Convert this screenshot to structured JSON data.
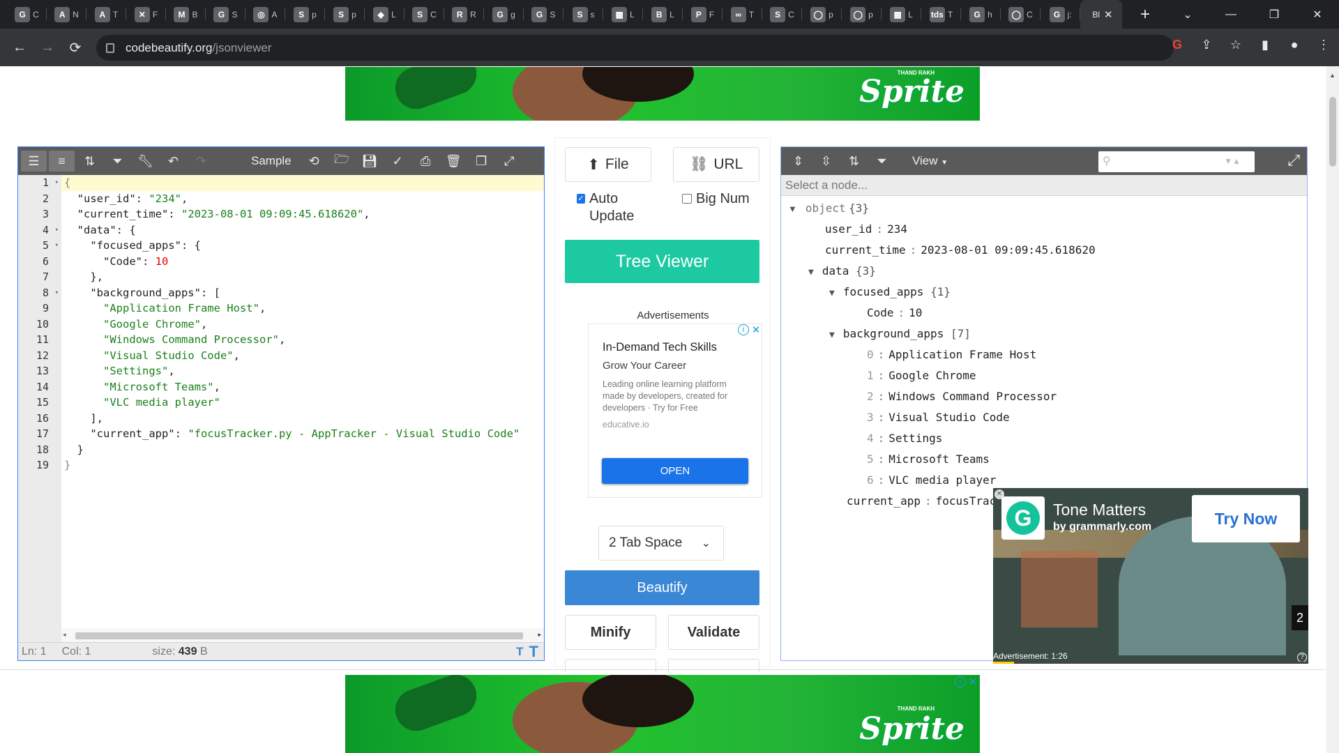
{
  "browser": {
    "tabs": [
      {
        "icon": "G",
        "title": "C"
      },
      {
        "icon": "A",
        "title": "N"
      },
      {
        "icon": "A",
        "title": "T"
      },
      {
        "icon": "✕",
        "title": "F"
      },
      {
        "icon": "M",
        "title": "B"
      },
      {
        "icon": "G",
        "title": "S"
      },
      {
        "icon": "◎",
        "title": "A"
      },
      {
        "icon": "S",
        "title": "p"
      },
      {
        "icon": "S",
        "title": "p"
      },
      {
        "icon": "◆",
        "title": "L"
      },
      {
        "icon": "S",
        "title": "C"
      },
      {
        "icon": "R",
        "title": "R"
      },
      {
        "icon": "G",
        "title": "g"
      },
      {
        "icon": "G",
        "title": "S"
      },
      {
        "icon": "S",
        "title": "s"
      },
      {
        "icon": "▦",
        "title": "L"
      },
      {
        "icon": "B",
        "title": "L"
      },
      {
        "icon": "P",
        "title": "F"
      },
      {
        "icon": "∞",
        "title": "T"
      },
      {
        "icon": "S",
        "title": "C"
      },
      {
        "icon": "◯",
        "title": "p"
      },
      {
        "icon": "◯",
        "title": "p"
      },
      {
        "icon": "▦",
        "title": "L"
      },
      {
        "icon": "tds",
        "title": "T"
      },
      {
        "icon": "G",
        "title": "h"
      },
      {
        "icon": "◯",
        "title": "C"
      },
      {
        "icon": "G",
        "title": "j:"
      }
    ],
    "active_tab": {
      "title": "Bl"
    },
    "new_tab": "+",
    "window_controls": {
      "dropdown": "⌄",
      "minimize": "—",
      "restore": "❐",
      "close": "✕"
    },
    "nav": {
      "back": "←",
      "forward": "→",
      "reload": "⟳"
    },
    "url_domain": "codebeautify.org",
    "url_path": "/jsonviewer"
  },
  "ads": {
    "banner_brand": "Sprite",
    "banner_tagline": "THAND RAKH",
    "middle_label": "Advertisements",
    "card": {
      "title": "In-Demand Tech Skills",
      "subtitle": "Grow Your Career",
      "description": "Leading online learning platform made by developers, created for developers · Try for Free",
      "domain": "educative.io",
      "cta": "OPEN"
    },
    "grammarly": {
      "title": "Tone Matters",
      "by": "by grammarly.com",
      "cta": "Try Now",
      "count": "2",
      "footer": "Advertisement: 1:26"
    }
  },
  "editor": {
    "sample_label": "Sample",
    "line_numbers": [
      "1",
      "2",
      "3",
      "4",
      "5",
      "6",
      "7",
      "8",
      "9",
      "10",
      "11",
      "12",
      "13",
      "14",
      "15",
      "16",
      "17",
      "18",
      "19"
    ],
    "status": {
      "ln_label": "Ln:",
      "ln": "1",
      "col_label": "Col:",
      "col": "1",
      "size_label": "size:",
      "size": "439",
      "size_unit": "B"
    }
  },
  "middle": {
    "file_btn": "File",
    "url_btn": "URL",
    "auto_update": "Auto Update",
    "auto_update_checked": true,
    "big_num": "Big Num",
    "tree_viewer": "Tree Viewer",
    "tab_space": "2 Tab Space",
    "beautify": "Beautify",
    "minify": "Minify",
    "validate": "Validate"
  },
  "tree": {
    "view_label": "View",
    "nav_placeholder": "Select a node...",
    "root": {
      "label": "object",
      "count": "{3}"
    },
    "user_id": {
      "key": "user_id",
      "value": "234"
    },
    "current_time": {
      "key": "current_time",
      "value": "2023-08-01 09:09:45.618620"
    },
    "data": {
      "key": "data",
      "count": "{3}"
    },
    "focused_apps": {
      "key": "focused_apps",
      "count": "{1}"
    },
    "code": {
      "key": "Code",
      "value": "10"
    },
    "background_apps": {
      "key": "background_apps",
      "count": "[7]"
    },
    "apps": [
      {
        "idx": "0",
        "val": "Application Frame Host"
      },
      {
        "idx": "1",
        "val": "Google Chrome"
      },
      {
        "idx": "2",
        "val": "Windows Command Processor"
      },
      {
        "idx": "3",
        "val": "Visual Studio Code"
      },
      {
        "idx": "4",
        "val": "Settings"
      },
      {
        "idx": "5",
        "val": "Microsoft Teams"
      },
      {
        "idx": "6",
        "val": "VLC media player"
      }
    ],
    "current_app": {
      "key": "current_app",
      "value": "focusTrac"
    }
  }
}
